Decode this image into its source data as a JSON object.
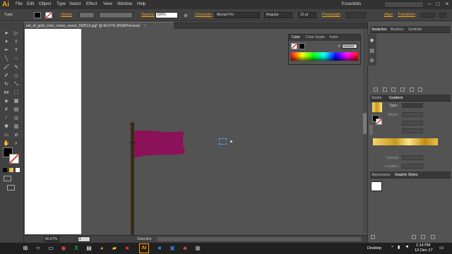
{
  "app": {
    "logo": "Ai",
    "workspace": "Essentials"
  },
  "menu": [
    "File",
    "Edit",
    "Object",
    "Type",
    "Select",
    "Effect",
    "View",
    "Window",
    "Help"
  ],
  "control_bar": {
    "selection_label": "Type",
    "stroke_label": "Stroke",
    "opacity_label": "Opacity",
    "opacity_value": "100%",
    "character_label": "Character",
    "font_family": "Myriad Pro",
    "font_style": "Regular",
    "font_size": "12 pt",
    "paragraph_label": "Paragraph",
    "align_label": "Align",
    "transform_label": "Transform"
  },
  "document_tab": {
    "title": "set_of_gold_color_crown_vector_599512.jpg* @ 66.67% (RGB/Preview)"
  },
  "color_panel": {
    "tabs": [
      "Color",
      "Color Guide",
      "Kuler"
    ],
    "hex_label": "#",
    "hex_value": "000000"
  },
  "right_panels": {
    "top_tabs": [
      "Swatches",
      "Brushes",
      "Symbols"
    ],
    "stroke_tab": "Stroke",
    "gradient_tab": "Gradient",
    "gradient_type_label": "Type:",
    "gradient_stroke_label": "Stroke:",
    "gradient_opacity_label": "Opacity:",
    "gradient_location_label": "Location:",
    "appearance_tab": "Appearance",
    "graphic_styles_tab": "Graphic Styles"
  },
  "status_bar": {
    "zoom": "66.67%",
    "page": "1",
    "tool": "Selection"
  },
  "taskbar": {
    "time": "1:14 PM",
    "date": "12-Dec-17",
    "desktop_label": "Desktop"
  },
  "colors": {
    "flag": "#8b1158",
    "pole": "#3a2a18",
    "accent": "#f7a21c"
  }
}
